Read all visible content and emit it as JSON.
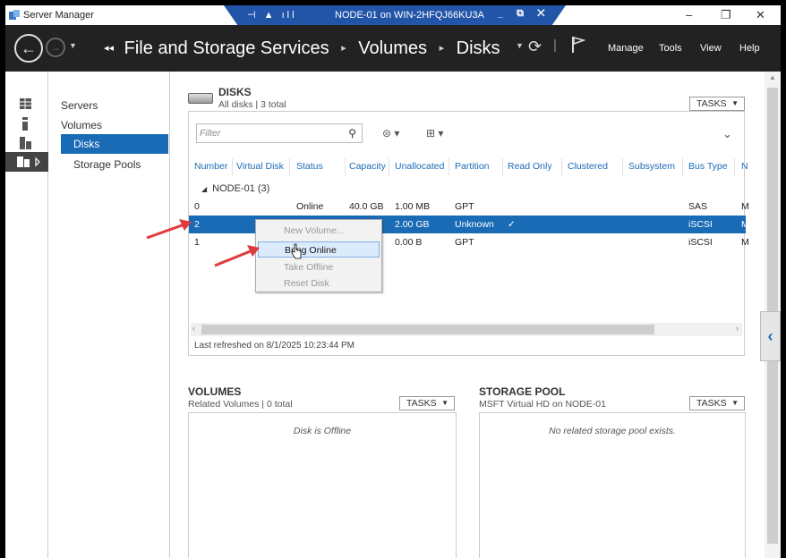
{
  "window": {
    "app_title": "Server Manager",
    "rdp_title": "NODE-01 on WIN-2HFQJ66KU3A",
    "rdp_left_icons": "⊣ ▲ ıll",
    "rdp_right_icons": "_ ⧉ ✕",
    "min": "–",
    "max": "❐",
    "close": "✕"
  },
  "nav": {
    "breadcrumb": [
      "File and Storage Services",
      "Volumes",
      "Disks"
    ],
    "menus": [
      "Manage",
      "Tools",
      "View",
      "Help"
    ]
  },
  "sidebar": {
    "items": [
      {
        "label": "Servers"
      },
      {
        "label": "Volumes"
      },
      {
        "label": "Disks"
      },
      {
        "label": "Storage Pools"
      }
    ]
  },
  "disks": {
    "title": "DISKS",
    "subtitle": "All disks | 3 total",
    "tasks_label": "TASKS",
    "filter_placeholder": "Filter",
    "columns": [
      "Number",
      "Virtual Disk",
      "Status",
      "Capacity",
      "Unallocated",
      "Partition",
      "Read Only",
      "Clustered",
      "Subsystem",
      "Bus Type",
      "N"
    ],
    "group": "NODE-01 (3)",
    "rows": [
      {
        "number": "0",
        "status": "Online",
        "capacity": "40.0 GB",
        "unallocated": "1.00 MB",
        "partition": "GPT",
        "read_only": "",
        "bus_type": "SAS",
        "n": "M"
      },
      {
        "number": "2",
        "status": "",
        "capacity": "",
        "unallocated": "2.00 GB",
        "partition": "Unknown",
        "read_only": "✓",
        "bus_type": "iSCSI",
        "n": "M"
      },
      {
        "number": "1",
        "status": "",
        "capacity": "",
        "unallocated": "0.00 B",
        "partition": "GPT",
        "read_only": "",
        "bus_type": "iSCSI",
        "n": "M"
      }
    ],
    "last_refreshed": "Last refreshed on 8/1/2025 10:23:44 PM"
  },
  "context_menu": {
    "items": [
      "New Volume...",
      "Bring Online",
      "Take Offline",
      "Reset Disk"
    ]
  },
  "volumes": {
    "title": "VOLUMES",
    "subtitle": "Related Volumes | 0 total",
    "tasks_label": "TASKS",
    "empty": "Disk is Offline"
  },
  "storage_pool": {
    "title": "STORAGE POOL",
    "subtitle": "MSFT Virtual HD on NODE-01",
    "tasks_label": "TASKS",
    "empty": "No related storage pool exists."
  },
  "colors": {
    "accent": "#1a6bb5",
    "navbar": "#222222",
    "rdp_bar": "#2255a8",
    "arrow": "#e0393e"
  }
}
